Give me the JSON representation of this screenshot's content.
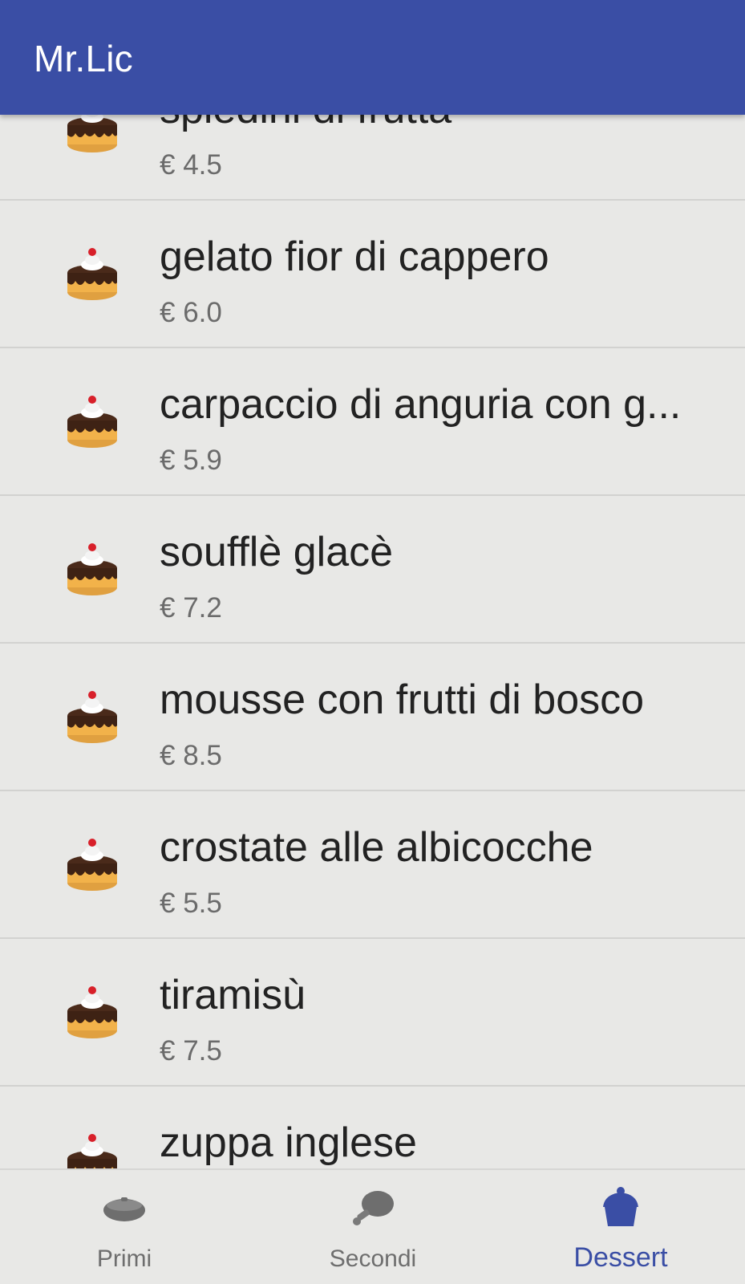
{
  "app": {
    "title": "Mr.Lic",
    "accent_color": "#3a4ea5",
    "background_color": "#e8e8e6"
  },
  "list": {
    "item_icon": "cake-icon",
    "items": [
      {
        "name": "spiedini di frutta",
        "price": "€ 4.5"
      },
      {
        "name": "gelato fior di cappero",
        "price": "€ 6.0"
      },
      {
        "name": "carpaccio di anguria con g...",
        "price": "€ 5.9"
      },
      {
        "name": "soufflè glacè",
        "price": "€ 7.2"
      },
      {
        "name": "mousse con frutti di bosco",
        "price": "€ 8.5"
      },
      {
        "name": "crostate alle albicocche",
        "price": "€ 5.5"
      },
      {
        "name": "tiramisù",
        "price": "€ 7.5"
      },
      {
        "name": "zuppa inglese",
        "price": ""
      }
    ]
  },
  "bottom_nav": {
    "tabs": [
      {
        "label": "Primi",
        "icon": "bowl-icon",
        "active": false
      },
      {
        "label": "Secondi",
        "icon": "chicken-leg-icon",
        "active": false
      },
      {
        "label": "Dessert",
        "icon": "cupcake-icon",
        "active": true
      }
    ]
  }
}
